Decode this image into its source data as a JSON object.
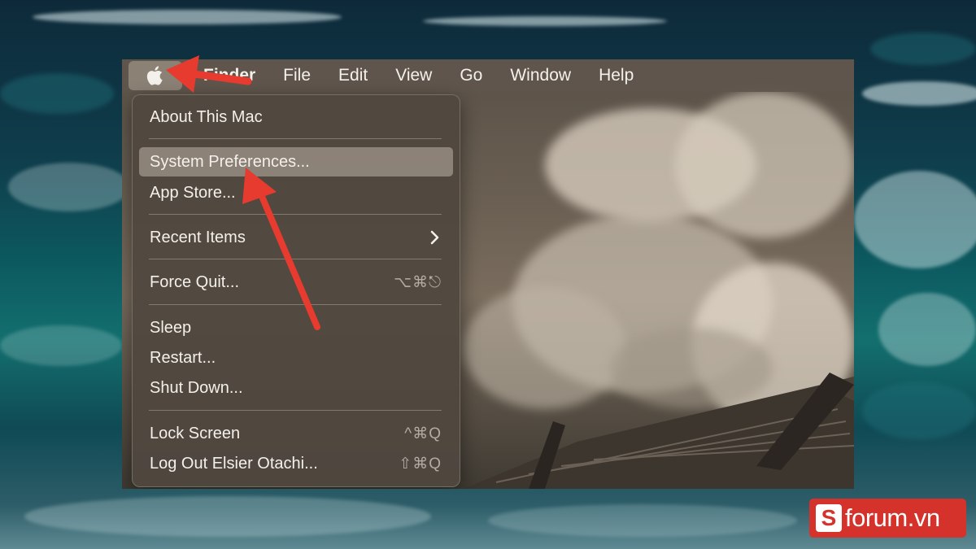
{
  "menubar": {
    "apple_icon": "apple-logo",
    "items": [
      {
        "label": "Finder"
      },
      {
        "label": "File"
      },
      {
        "label": "Edit"
      },
      {
        "label": "View"
      },
      {
        "label": "Go"
      },
      {
        "label": "Window"
      },
      {
        "label": "Help"
      }
    ]
  },
  "apple_menu": {
    "about": {
      "label": "About This Mac"
    },
    "system_preferences": {
      "label": "System Preferences..."
    },
    "app_store": {
      "label": "App Store..."
    },
    "recent_items": {
      "label": "Recent Items",
      "submenu_icon": "chevron-right"
    },
    "force_quit": {
      "label": "Force Quit...",
      "shortcut": "⌥⌘⎋"
    },
    "sleep": {
      "label": "Sleep"
    },
    "restart": {
      "label": "Restart..."
    },
    "shut_down": {
      "label": "Shut Down..."
    },
    "lock_screen": {
      "label": "Lock Screen",
      "shortcut": "^⌘Q"
    },
    "log_out": {
      "label": "Log Out Elsier Otachi...",
      "shortcut": "⇧⌘Q"
    }
  },
  "watermark": {
    "badge": "S",
    "text": "forum.vn"
  },
  "colors": {
    "accent_red": "#e63b2e",
    "logo_red": "#d5322c"
  }
}
